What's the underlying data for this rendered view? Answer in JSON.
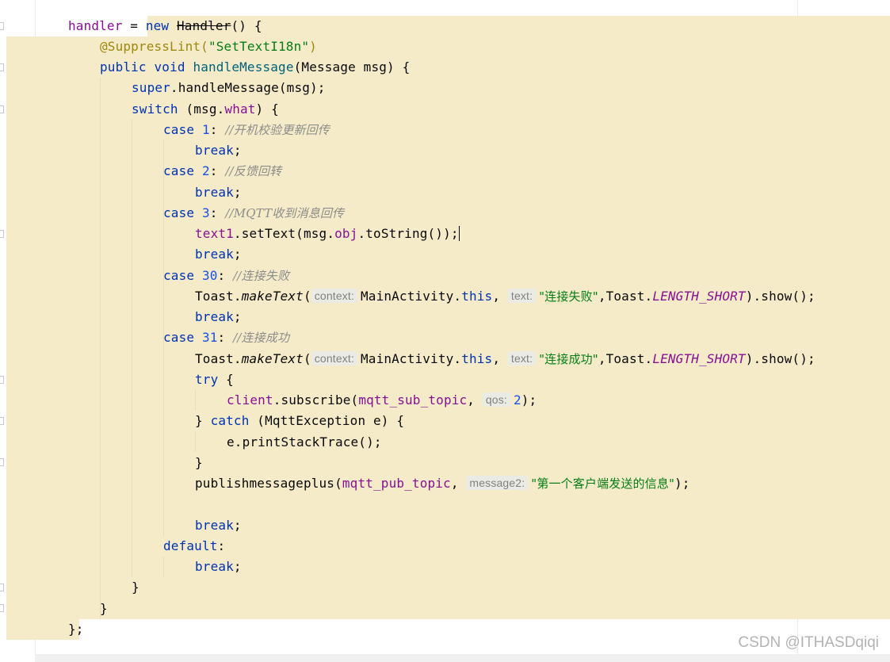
{
  "editor": {
    "colors": {
      "selection_highlight": "#f5ebc8",
      "keyword": "#0033b3",
      "field": "#871094",
      "method": "#00627a",
      "string": "#067d17",
      "number": "#1750eb",
      "comment": "#8c8c8c",
      "annotation": "#9e880d"
    },
    "code": {
      "l1": {
        "a": "handler",
        "b": " = ",
        "c": "new",
        "d": " ",
        "e": "Handler",
        "f": "() {"
      },
      "l2": {
        "a": "@SuppressLint(",
        "b": "\"SetTextI18n\"",
        "c": ")"
      },
      "l3": {
        "a": "public",
        "b": " ",
        "c": "void",
        "d": " ",
        "e": "handleMessage",
        "f": "(Message msg) {"
      },
      "l4": {
        "a": "super",
        "b": ".handleMessage(msg);"
      },
      "l5": {
        "a": "switch",
        "b": " (msg.",
        "c": "what",
        "d": ") {"
      },
      "l6": {
        "a": "case",
        "b": " ",
        "c": "1",
        "d": ": ",
        "e": "//开机校验更新回传"
      },
      "l7": {
        "a": "break",
        "b": ";"
      },
      "l8": {
        "a": "case",
        "b": " ",
        "c": "2",
        "d": ": ",
        "e": "//反馈回转"
      },
      "l9": {
        "a": "break",
        "b": ";"
      },
      "l10": {
        "a": "case",
        "b": " ",
        "c": "3",
        "d": ": ",
        "e": "//MQTT收到消息回传"
      },
      "l11": {
        "a": "text1",
        "b": ".setText(msg.",
        "c": "obj",
        "d": ".toString());"
      },
      "l12": {
        "a": "break",
        "b": ";"
      },
      "l13": {
        "a": "case",
        "b": " ",
        "c": "30",
        "d": ": ",
        "e": "//连接失败"
      },
      "l14": {
        "a": "Toast.",
        "b": "makeText",
        "c": "(",
        "h1": "context:",
        "d": "MainActivity.",
        "e": "this",
        "f": ", ",
        "h2": "text:",
        "g": "\"连接失败\"",
        "i": ",Toast.",
        "j": "LENGTH_SHORT",
        "k": ").show();"
      },
      "l15": {
        "a": "break",
        "b": ";"
      },
      "l16": {
        "a": "case",
        "b": " ",
        "c": "31",
        "d": ": ",
        "e": "//连接成功"
      },
      "l17": {
        "a": "Toast.",
        "b": "makeText",
        "c": "(",
        "h1": "context:",
        "d": "MainActivity.",
        "e": "this",
        "f": ", ",
        "h2": "text:",
        "g": "\"连接成功\"",
        "i": ",Toast.",
        "j": "LENGTH_SHORT",
        "k": ").show();"
      },
      "l18": {
        "a": "try",
        "b": " {"
      },
      "l19": {
        "a": "client",
        "b": ".subscribe(",
        "c": "mqtt_sub_topic",
        "d": ", ",
        "h1": "qos:",
        "e": "2",
        "f": ");"
      },
      "l20": {
        "a": "} ",
        "b": "catch",
        "c": " (MqttException e) {"
      },
      "l21": {
        "a": "e.printStackTrace();"
      },
      "l22": {
        "a": "}"
      },
      "l23": {
        "a": "publishmessageplus(",
        "b": "mqtt_pub_topic",
        "c": ", ",
        "h1": "message2:",
        "d": "\"第一个客户端发送的信息\"",
        "e": ");"
      },
      "l24": {
        "a": ""
      },
      "l25": {
        "a": "break",
        "b": ";"
      },
      "l26": {
        "a": "default",
        "b": ":"
      },
      "l27": {
        "a": "break",
        "b": ";"
      },
      "l28": {
        "a": "}"
      },
      "l29": {
        "a": "}"
      },
      "l30": {
        "a": "};"
      }
    }
  },
  "watermark": "CSDN @ITHASDqiqi"
}
